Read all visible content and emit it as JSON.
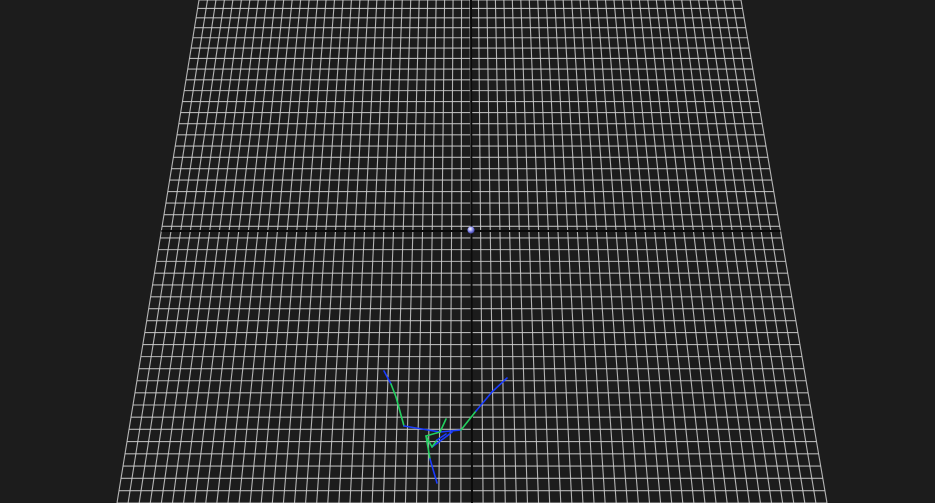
{
  "viewport": {
    "background_color": "#1c1c1c",
    "grid": {
      "line_color": "#cfcfcf",
      "axis_color": "#0a0a0a",
      "visible": true
    },
    "origin_marker": {
      "icon": "origin-sphere-icon",
      "color": "#8a8cf0"
    },
    "skeleton": {
      "icon": "skeleton-figure-icon",
      "bone_colors": [
        "#1a3cff",
        "#22d060"
      ]
    }
  }
}
